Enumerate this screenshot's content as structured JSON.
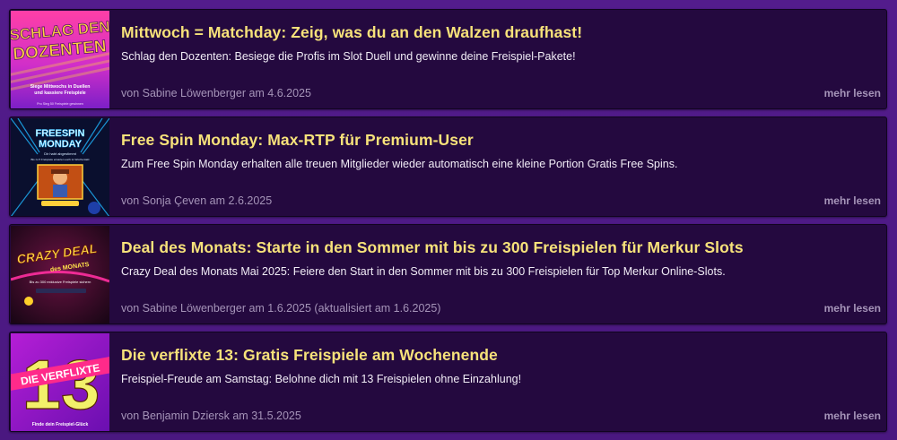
{
  "posts": [
    {
      "title": "Mittwoch = Matchday: Zeig, was du an den Walzen draufhast!",
      "excerpt": "Schlag den Dozenten: Besiege die Profis im Slot Duell und gewinne deine Freispiel-Pakete!",
      "meta": "von Sabine Löwenberger am 4.6.2025",
      "more_label": "mehr lesen",
      "image": {
        "line1": "SCHLAG DEN",
        "line2": "DOZENTEN",
        "tagline1": "Siege Mittwochs in Duellen",
        "tagline2": "und kassiere Freispiele",
        "fineprint": "Pro Sieg 50 Freispiele gewinnen"
      }
    },
    {
      "title": "Free Spin Monday: Max-RTP für Premium-User",
      "excerpt": "Zum Free Spin Monday erhalten alle treuen Mitglieder wieder automatisch eine kleine Portion Gratis Free Spins.",
      "meta": "von Sonja Çeven am 2.6.2025",
      "more_label": "mehr lesen",
      "image": {
        "line1": "FREESPIN",
        "line2": "MONDAY",
        "tagline1": "Dir habt abgestimmt",
        "tagline2": "Bis zu 5 Freispiele erwarten euch im Wochentakt"
      }
    },
    {
      "title": "Deal des Monats: Starte in den Sommer mit bis zu 300 Freispielen für Merkur Slots",
      "excerpt": "Crazy Deal des Monats Mai 2025: Feiere den Start in den Sommer mit bis zu 300 Freispielen für Top Merkur Online-Slots.",
      "meta": "von Sabine Löwenberger am 1.6.2025 (aktualisiert am 1.6.2025)",
      "more_label": "mehr lesen",
      "image": {
        "line1": "CRAZY DEAL",
        "line2": "des MONATS",
        "tagline1": "Bis zu 300 exklusive Freispiele sichern"
      }
    },
    {
      "title": "Die verflixte 13: Gratis Freispiele am Wochenende",
      "excerpt": "Freispiel-Freude am Samstag: Belohne dich mit 13 Freispielen ohne Einzahlung!",
      "meta": "von Benjamin Dziersk am 31.5.2025",
      "more_label": "mehr lesen",
      "image": {
        "number": "13",
        "banner": "DIE VERFLIXTE",
        "tagline1": "Finde dein Freispiel-Glück"
      }
    }
  ]
}
